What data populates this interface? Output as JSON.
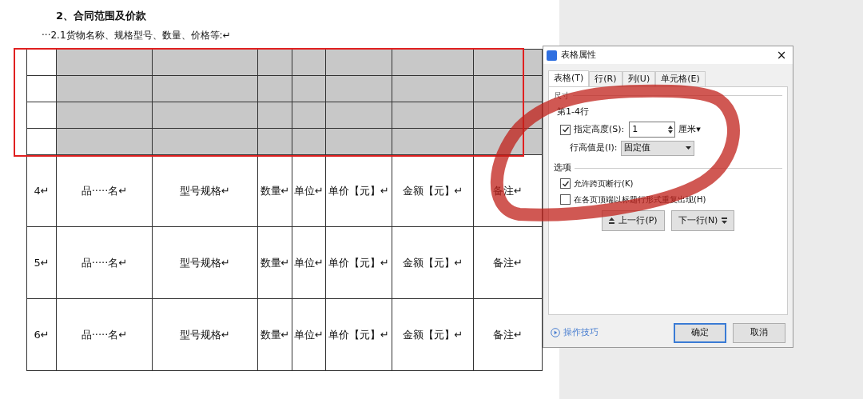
{
  "document": {
    "heading": "2、合同范围及价款",
    "paragraph": "···2.1货物名称、规格型号、数量、价格等:↵",
    "table": {
      "rows": [
        {
          "selected": true
        },
        {
          "selected": true
        },
        {
          "selected": true
        },
        {
          "selected": true
        },
        {
          "selected": false,
          "cells": [
            "4↵",
            "品·····名↵",
            "型号规格↵",
            "数量↵",
            "单位↵",
            "单价【元】↵",
            "金额【元】↵",
            "备注↵"
          ]
        },
        {
          "selected": false,
          "cells": [
            "5↵",
            "品·····名↵",
            "型号规格↵",
            "数量↵",
            "单位↵",
            "单价【元】↵",
            "金额【元】↵",
            "备注↵"
          ]
        },
        {
          "selected": false,
          "cells": [
            "6↵",
            "品·····名↵",
            "型号规格↵",
            "数量↵",
            "单位↵",
            "单价【元】↵",
            "金额【元】↵",
            "备注↵"
          ]
        }
      ]
    }
  },
  "dialog": {
    "title": "表格属性",
    "close": "×",
    "tabs": [
      {
        "label": "表格(T)",
        "selected": true
      },
      {
        "label": "行(R)",
        "selected": false
      },
      {
        "label": "列(U)",
        "selected": false
      },
      {
        "label": "单元格(E)",
        "selected": false
      }
    ],
    "size_section": {
      "title": "尺寸",
      "rows_label": "第1-4行",
      "height": {
        "label": "指定高度(S):",
        "checked": true,
        "value": "1",
        "unit": "厘米▾"
      },
      "mode": {
        "label": "行高值是(I):",
        "value": "固定值"
      }
    },
    "options_section": {
      "title": "选项",
      "options": [
        {
          "label": "允许跨页断行(K)",
          "checked": true
        },
        {
          "label": "在各页顶端以标题行形式重复出现(H)",
          "checked": false
        }
      ]
    },
    "nav_buttons": [
      {
        "label": "上一行(P)",
        "kind": "up"
      },
      {
        "label": "下一行(N)",
        "kind": "down"
      }
    ],
    "tips_link": "操作技巧",
    "ok": "确定",
    "cancel": "取消"
  }
}
